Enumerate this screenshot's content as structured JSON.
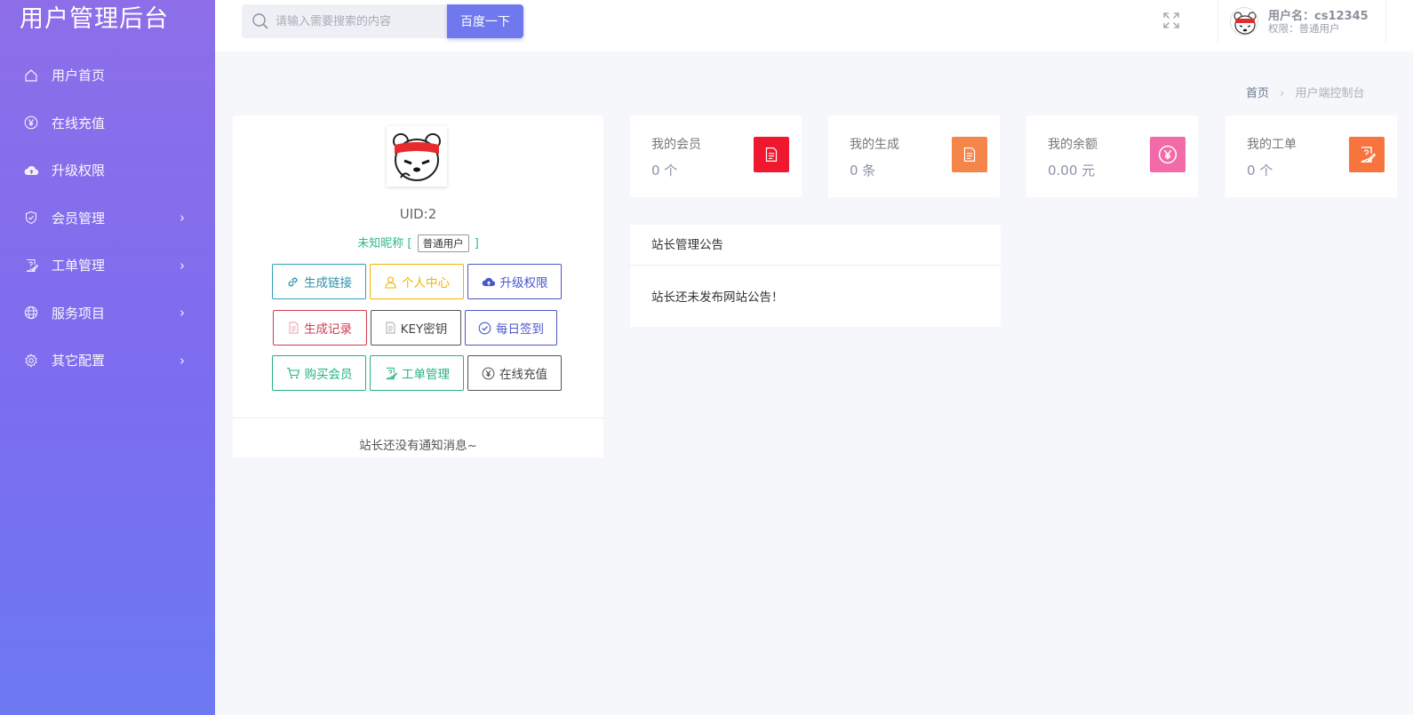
{
  "sidebar": {
    "brand": "用户管理后台",
    "items": [
      {
        "label": "用户首页",
        "icon": "home-icon"
      },
      {
        "label": "在线充值",
        "icon": "yen-circle-icon"
      },
      {
        "label": "升级权限",
        "icon": "cloud-upload-icon"
      },
      {
        "label": "会员管理",
        "icon": "shield-check-icon",
        "chevron": "›"
      },
      {
        "label": "工单管理",
        "icon": "ticket-edit-icon",
        "chevron": "›"
      },
      {
        "label": "服务项目",
        "icon": "globe-icon",
        "chevron": "›"
      },
      {
        "label": "其它配置",
        "icon": "gear-icon",
        "chevron": "›"
      }
    ]
  },
  "header": {
    "search_placeholder": "请输入需要搜索的内容",
    "search_button": "百度一下",
    "username_line": "用户名：cs12345",
    "role_line": "权限：普通用户"
  },
  "breadcrumb": {
    "home": "首页",
    "sep": "›",
    "current": "用户端控制台"
  },
  "profile": {
    "uid": "UID:2",
    "nickname": "未知昵称",
    "bracket_open": "[",
    "bracket_close": "]",
    "level_badge": "普通用户",
    "buttons": [
      {
        "label": "生成链接",
        "icon": "link-icon"
      },
      {
        "label": "个人中心",
        "icon": "user-icon"
      },
      {
        "label": "升级权限",
        "icon": "cloud-upload-icon"
      },
      {
        "label": "生成记录",
        "icon": "document-icon"
      },
      {
        "label": "KEY密钥",
        "icon": "document-icon"
      },
      {
        "label": "每日签到",
        "icon": "check-circle-icon"
      },
      {
        "label": "购买会员",
        "icon": "cart-icon"
      },
      {
        "label": "工单管理",
        "icon": "ticket-edit-icon"
      },
      {
        "label": "在线充值",
        "icon": "yen-circle-icon"
      }
    ],
    "notice": "站长还没有通知消息~"
  },
  "stats": [
    {
      "label": "我的会员",
      "value": "0 个",
      "color": "#f0182f",
      "icon": "document-icon"
    },
    {
      "label": "我的生成",
      "value": "0 条",
      "color": "#f6854a",
      "icon": "document-icon"
    },
    {
      "label": "我的余额",
      "value": "0.00 元",
      "color": "#f26aa8",
      "icon": "yen-circle-icon"
    },
    {
      "label": "我的工单",
      "value": "0 个",
      "color": "#f7743f",
      "icon": "ticket-edit-icon"
    }
  ],
  "announcement": {
    "title": "站长管理公告",
    "body": "站长还未发布网站公告！"
  },
  "colors": {
    "sidebar_top": "#8d6ee8",
    "sidebar_bottom": "#6d79f2",
    "search_button": "#6f78ec"
  }
}
